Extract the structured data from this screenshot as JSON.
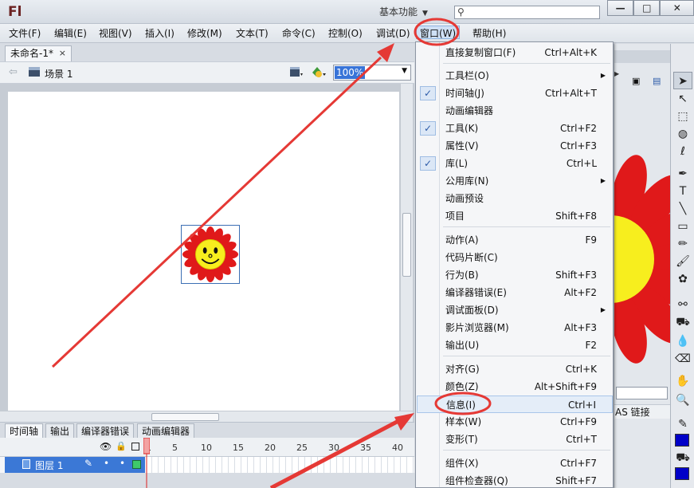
{
  "app": {
    "logo": "Fl",
    "workspace": "基本功能"
  },
  "window_controls": [
    "—",
    "□",
    "✕"
  ],
  "menubar": [
    {
      "label": "文件(F)"
    },
    {
      "label": "编辑(E)"
    },
    {
      "label": "视图(V)"
    },
    {
      "label": "插入(I)"
    },
    {
      "label": "修改(M)"
    },
    {
      "label": "文本(T)"
    },
    {
      "label": "命令(C)"
    },
    {
      "label": "控制(O)"
    },
    {
      "label": "调试(D)"
    },
    {
      "label": "窗口(W)"
    },
    {
      "label": "帮助(H)"
    }
  ],
  "document": {
    "tab_title": "未命名-1*",
    "tab_close": "×",
    "scene": "场景 1",
    "zoom": "100%"
  },
  "timeline": {
    "tabs": [
      "时间轴",
      "输出",
      "编译器错误",
      "动画编辑器"
    ],
    "frame_numbers": [
      "1",
      "5",
      "10",
      "15",
      "20",
      "25",
      "30",
      "35",
      "40"
    ],
    "layer": "图层 1"
  },
  "window_menu": [
    {
      "label": "直接复制窗口(F)",
      "shortcut": "Ctrl+Alt+K"
    },
    {
      "sep": true
    },
    {
      "label": "工具栏(O)",
      "submenu": true
    },
    {
      "label": "时间轴(J)",
      "shortcut": "Ctrl+Alt+T",
      "checked": true
    },
    {
      "label": "动画编辑器"
    },
    {
      "label": "工具(K)",
      "shortcut": "Ctrl+F2",
      "checked": true
    },
    {
      "label": "属性(V)",
      "shortcut": "Ctrl+F3"
    },
    {
      "label": "库(L)",
      "shortcut": "Ctrl+L",
      "checked": true
    },
    {
      "label": "公用库(N)",
      "submenu": true
    },
    {
      "label": "动画预设"
    },
    {
      "label": "项目",
      "shortcut": "Shift+F8"
    },
    {
      "sep": true
    },
    {
      "label": "动作(A)",
      "shortcut": "F9"
    },
    {
      "label": "代码片断(C)"
    },
    {
      "label": "行为(B)",
      "shortcut": "Shift+F3"
    },
    {
      "label": "编译器错误(E)",
      "shortcut": "Alt+F2"
    },
    {
      "label": "调试面板(D)",
      "submenu": true
    },
    {
      "label": "影片浏览器(M)",
      "shortcut": "Alt+F3"
    },
    {
      "label": "输出(U)",
      "shortcut": "F2"
    },
    {
      "sep": true
    },
    {
      "label": "对齐(G)",
      "shortcut": "Ctrl+K"
    },
    {
      "label": "颜色(Z)",
      "shortcut": "Alt+Shift+F9"
    },
    {
      "label": "信息(I)",
      "shortcut": "Ctrl+I",
      "highlighted": true
    },
    {
      "label": "样本(W)",
      "shortcut": "Ctrl+F9"
    },
    {
      "label": "变形(T)",
      "shortcut": "Ctrl+T"
    },
    {
      "sep": true
    },
    {
      "label": "组件(X)",
      "shortcut": "Ctrl+F7"
    },
    {
      "label": "组件检查器(Q)",
      "shortcut": "Shift+F7"
    }
  ],
  "right_panel": {
    "as_link": "AS 链接"
  },
  "tools": [
    "selection-tool",
    "subselection-tool",
    "free-transform-tool",
    "3d-rotation-tool",
    "lasso-tool",
    "pen-tool",
    "text-tool",
    "line-tool",
    "rectangle-tool",
    "pencil-tool",
    "brush-tool",
    "deco-tool",
    "bone-tool",
    "paint-bucket-tool",
    "eyedropper-tool",
    "eraser-tool",
    "hand-tool",
    "zoom-tool"
  ],
  "colors": {
    "accent": "#3874d8",
    "annotation": "#e53935",
    "stroke_swatch": "#0000c8",
    "fill_swatch": "#0000c8"
  }
}
